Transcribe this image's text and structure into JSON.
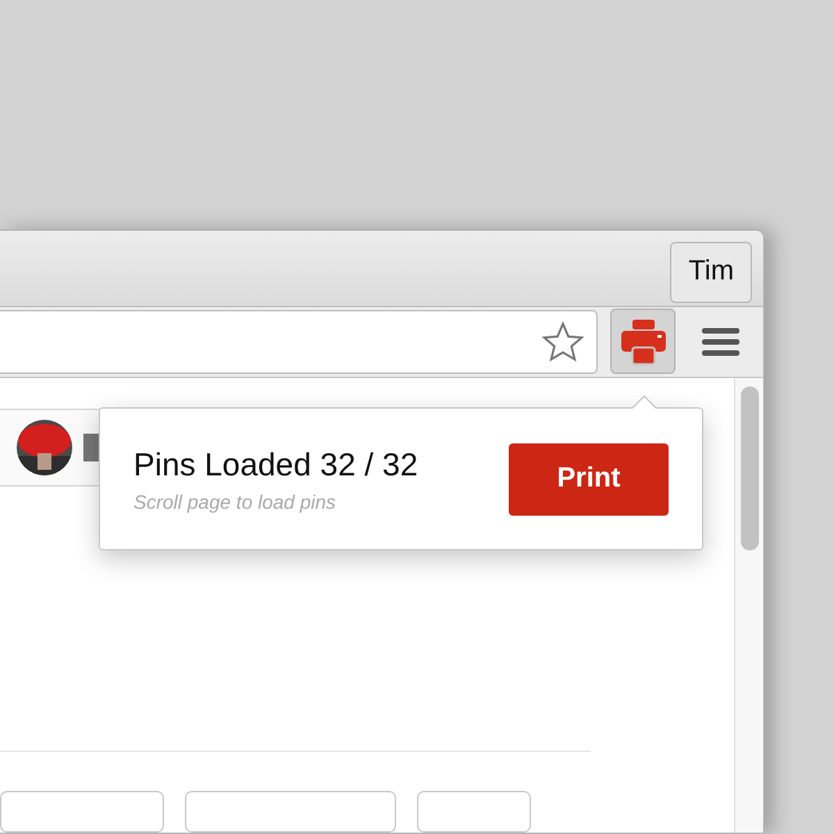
{
  "profile_button": "Tim",
  "popup": {
    "title": "Pins Loaded 32 / 32",
    "hint": "Scroll page to load pins",
    "button": "Print"
  }
}
